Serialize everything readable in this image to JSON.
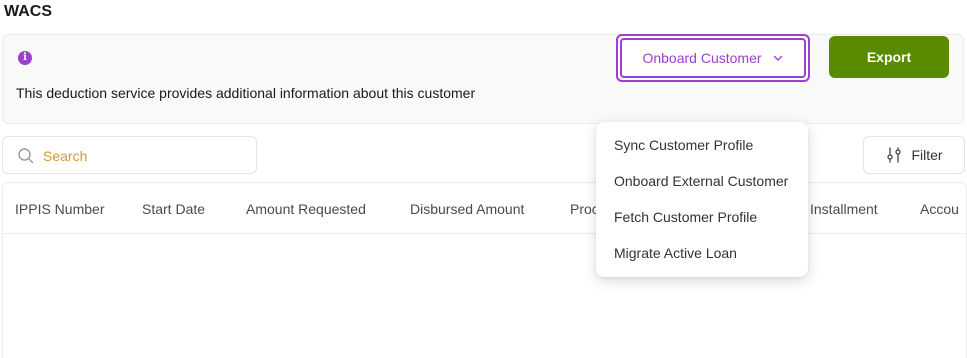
{
  "page": {
    "title": "WACS"
  },
  "banner": {
    "info_icon": "info-icon",
    "info_glyph": "i",
    "text": "This deduction service provides additional information about this customer",
    "accent_color": "#9b3fd1"
  },
  "actions": {
    "onboard_label": "Onboard Customer",
    "onboard_icon": "chevron-down-icon",
    "export_label": "Export",
    "export_color": "#5a8a00"
  },
  "search": {
    "placeholder": "Search",
    "icon": "search-icon"
  },
  "filter": {
    "label": "Filter",
    "icon": "sliders-icon"
  },
  "table": {
    "columns": [
      "IPPIS Number",
      "Start Date",
      "Amount Requested",
      "Disbursed Amount",
      "Proc",
      "Installment",
      "Accou"
    ]
  },
  "dropdown": {
    "items": [
      "Sync Customer Profile",
      "Onboard External Customer",
      "Fetch Customer Profile",
      "Migrate Active Loan"
    ]
  }
}
